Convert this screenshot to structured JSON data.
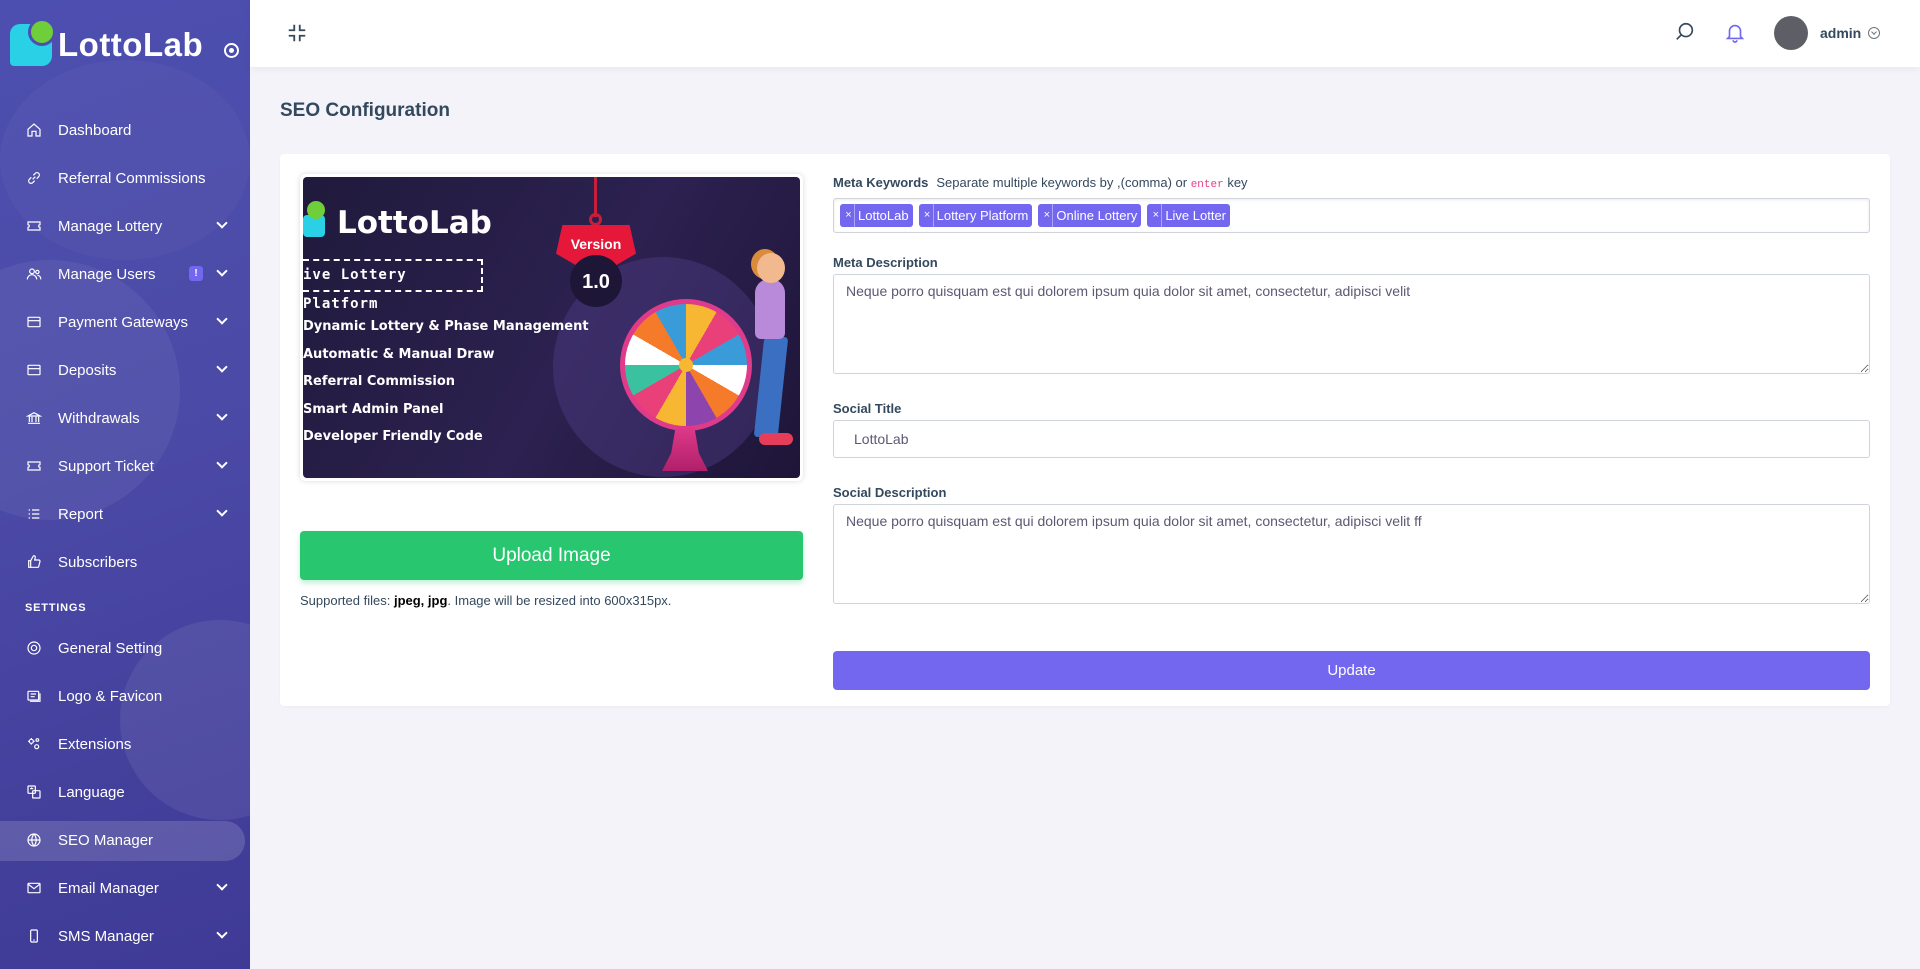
{
  "brand": {
    "name": "LottoLab"
  },
  "sidebar": {
    "items": [
      {
        "label": "Dashboard",
        "icon": "home-icon"
      },
      {
        "label": "Referral Commissions",
        "icon": "link-icon"
      },
      {
        "label": "Manage Lottery",
        "icon": "ticket-icon"
      },
      {
        "label": "Manage Users",
        "icon": "users-icon",
        "badge": "!"
      },
      {
        "label": "Payment Gateways",
        "icon": "credit-card-icon"
      },
      {
        "label": "Deposits",
        "icon": "credit-card-icon"
      },
      {
        "label": "Withdrawals",
        "icon": "bank-icon"
      },
      {
        "label": "Support Ticket",
        "icon": "ticket-icon"
      },
      {
        "label": "Report",
        "icon": "list-icon"
      },
      {
        "label": "Subscribers",
        "icon": "thumbs-up-icon"
      }
    ],
    "settings_heading": "SETTINGS",
    "settings_items": [
      {
        "label": "General Setting",
        "icon": "life-ring-icon"
      },
      {
        "label": "Logo & Favicon",
        "icon": "images-icon"
      },
      {
        "label": "Extensions",
        "icon": "cogs-icon"
      },
      {
        "label": "Language",
        "icon": "language-icon"
      },
      {
        "label": "SEO Manager",
        "icon": "globe-icon",
        "active": true
      },
      {
        "label": "Email Manager",
        "icon": "envelope-icon"
      },
      {
        "label": "SMS Manager",
        "icon": "mobile-icon"
      }
    ]
  },
  "header": {
    "username": "admin"
  },
  "page": {
    "title": "SEO Configuration"
  },
  "preview": {
    "logo_text": "LottoLab",
    "tagline": "ive Lottery Platform",
    "version_label": "Version",
    "version_number": "1.0",
    "features": [
      "Dynamic Lottery & Phase Management",
      "Automatic & Manual Draw",
      "Referral Commission",
      "Smart Admin Panel",
      "Developer Friendly Code"
    ]
  },
  "upload": {
    "button_label": "Upload Image",
    "note_prefix": "Supported files: ",
    "note_types": "jpeg, jpg",
    "note_suffix": ". Image will be resized into 600x315px."
  },
  "form": {
    "meta_keywords_label": "Meta Keywords",
    "meta_keywords_hint_prefix": "Separate multiple keywords by ",
    "meta_keywords_hint_comma": ",(comma) or ",
    "meta_keywords_hint_key": "enter",
    "meta_keywords_hint_suffix": " key",
    "keywords": [
      "LottoLab",
      "Lottery Platform",
      "Online Lottery",
      "Live Lotter"
    ],
    "tag_remove": "×",
    "meta_description_label": "Meta Description",
    "meta_description_value": "Neque porro quisquam est qui dolorem ipsum quia dolor sit amet, consectetur, adipisci velit",
    "social_title_label": "Social Title",
    "social_title_value": "LottoLab",
    "social_description_label": "Social Description",
    "social_description_value": "Neque porro quisquam est qui dolorem ipsum quia dolor sit amet, consectetur, adipisci velit ff",
    "update_label": "Update"
  },
  "colors": {
    "sidebar": "#4b4aa6",
    "primary": "#7367f0",
    "success": "#28c76f",
    "bell": "#7367f0"
  }
}
